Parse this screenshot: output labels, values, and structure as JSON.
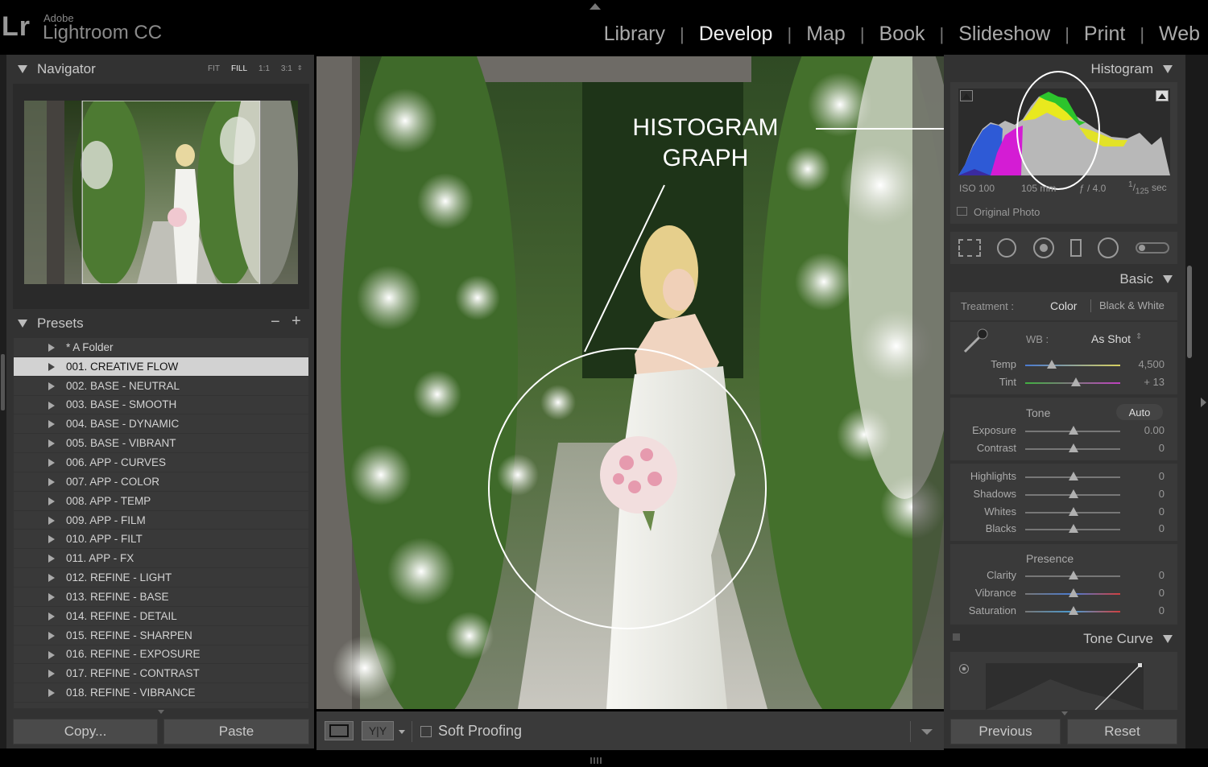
{
  "app": {
    "adobe": "Adobe",
    "name": "Lightroom CC",
    "logo": "Lr"
  },
  "modules": [
    "Library",
    "Develop",
    "Map",
    "Book",
    "Slideshow",
    "Print",
    "Web"
  ],
  "active_module": "Develop",
  "navigator": {
    "title": "Navigator",
    "zoom": [
      "FIT",
      "FILL",
      "1:1",
      "3:1"
    ],
    "active_zoom": "FILL"
  },
  "presets": {
    "title": "Presets",
    "minus": "−",
    "plus": "+",
    "items": [
      "* A Folder",
      "001. CREATIVE FLOW",
      "002. BASE - NEUTRAL",
      "003. BASE - SMOOTH",
      "004. BASE - DYNAMIC",
      "005. BASE - VIBRANT",
      "006. APP - CURVES",
      "007. APP - COLOR",
      "008. APP - TEMP",
      "009. APP - FILM",
      "010. APP - FILT",
      "011. APP - FX",
      "012. REFINE - LIGHT",
      "013. REFINE - BASE",
      "014. REFINE - DETAIL",
      "015. REFINE - SHARPEN",
      "016. REFINE - EXPOSURE",
      "017. REFINE - CONTRAST",
      "018. REFINE - VIBRANCE"
    ],
    "selected_index": 1
  },
  "left_buttons": {
    "copy": "Copy...",
    "paste": "Paste"
  },
  "annotation": {
    "line1": "HISTOGRAM",
    "line2": "GRAPH"
  },
  "toolbar": {
    "soft_proofing": "Soft Proofing"
  },
  "histogram": {
    "title": "Histogram",
    "iso": "ISO 100",
    "focal": "105 mm",
    "aperture": "ƒ / 4.0",
    "shutter_num": "1",
    "shutter_den": "125",
    "shutter_unit": "sec",
    "original_photo": "Original Photo"
  },
  "basic": {
    "title": "Basic",
    "treatment_label": "Treatment :",
    "color": "Color",
    "bw": "Black & White",
    "wb_label": "WB :",
    "wb_value": "As Shot",
    "tone": "Tone",
    "auto": "Auto",
    "presence": "Presence",
    "sliders": [
      {
        "label": "Temp",
        "value": "4,500"
      },
      {
        "label": "Tint",
        "value": "+ 13"
      },
      {
        "label": "Exposure",
        "value": "0.00"
      },
      {
        "label": "Contrast",
        "value": "0"
      },
      {
        "label": "Highlights",
        "value": "0"
      },
      {
        "label": "Shadows",
        "value": "0"
      },
      {
        "label": "Whites",
        "value": "0"
      },
      {
        "label": "Blacks",
        "value": "0"
      },
      {
        "label": "Clarity",
        "value": "0"
      },
      {
        "label": "Vibrance",
        "value": "0"
      },
      {
        "label": "Saturation",
        "value": "0"
      }
    ]
  },
  "tone_curve": {
    "title": "Tone Curve"
  },
  "right_buttons": {
    "previous": "Previous",
    "reset": "Reset"
  }
}
